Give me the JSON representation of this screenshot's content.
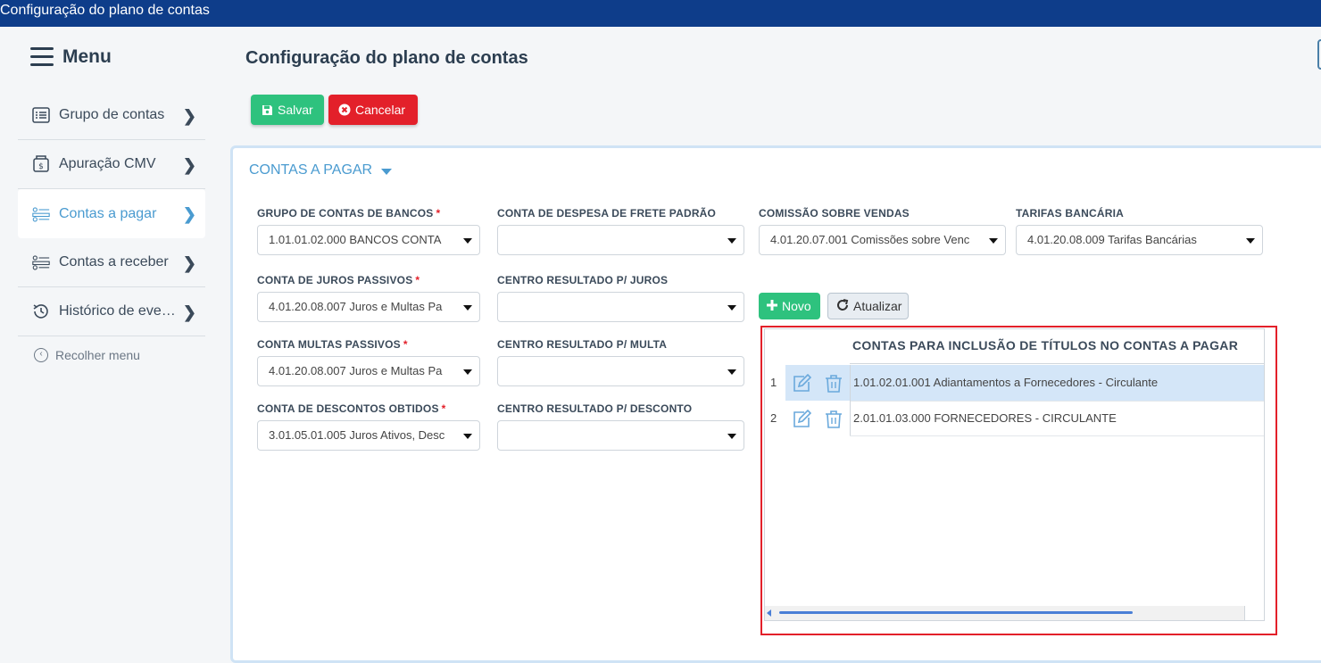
{
  "window": {
    "title": "Configuração do plano de contas"
  },
  "sidebar": {
    "menu_title": "Menu",
    "items": [
      {
        "label": "Grupo de contas",
        "icon": "list-icon",
        "active": false
      },
      {
        "label": "Apuração CMV",
        "icon": "money-box-icon",
        "active": false
      },
      {
        "label": "Contas a pagar",
        "icon": "accounts-list-icon",
        "active": true
      },
      {
        "label": "Contas a receber",
        "icon": "accounts-list-icon",
        "active": false
      },
      {
        "label": "Histórico de eve…",
        "icon": "history-icon",
        "active": false
      }
    ],
    "collapse_label": "Recolher menu"
  },
  "page": {
    "title": "Configuração do plano de contas",
    "save_label": "Salvar",
    "cancel_label": "Cancelar"
  },
  "section": {
    "title": "CONTAS A PAGAR",
    "fields": {
      "grupo_bancos": {
        "label": "GRUPO DE CONTAS DE BANCOS",
        "required": "*",
        "value": "1.01.01.02.000 BANCOS CONTA"
      },
      "despesa_frete": {
        "label": "CONTA DE DESPESA DE FRETE PADRÃO",
        "value": ""
      },
      "comissao": {
        "label": "COMISSÃO SOBRE VENDAS",
        "value": "4.01.20.07.001 Comissões sobre Venc"
      },
      "tarifas": {
        "label": "TARIFAS BANCÁRIA",
        "value": "4.01.20.08.009 Tarifas Bancárias"
      },
      "juros_passivos": {
        "label": "CONTA DE JUROS PASSIVOS",
        "required": "*",
        "value": "4.01.20.08.007 Juros e Multas Pa"
      },
      "centro_juros": {
        "label": "CENTRO RESULTADO P/ JUROS",
        "value": ""
      },
      "multas_passivos": {
        "label": "CONTA MULTAS PASSIVOS",
        "required": "*",
        "value": "4.01.20.08.007 Juros e Multas Pa"
      },
      "centro_multa": {
        "label": "CENTRO RESULTADO P/ MULTA",
        "value": ""
      },
      "descontos": {
        "label": "CONTA DE DESCONTOS OBTIDOS",
        "required": "*",
        "value": "3.01.05.01.005 Juros Ativos, Desc"
      },
      "centro_desconto": {
        "label": "CENTRO RESULTADO P/ DESCONTO",
        "value": ""
      }
    },
    "novo_label": "Novo",
    "atualizar_label": "Atualizar",
    "grid": {
      "title": "CONTAS PARA INCLUSÃO DE TÍTULOS NO CONTAS A PAGAR",
      "rows": [
        {
          "num": "1",
          "value": "1.01.02.01.001 Adiantamentos a Fornecedores - Circulante",
          "selected": true
        },
        {
          "num": "2",
          "value": "2.01.01.03.000 FORNECEDORES - CIRCULANTE",
          "selected": false
        }
      ]
    }
  },
  "colors": {
    "titlebar": "#0e3d8a",
    "accent": "#4a9bd0",
    "success": "#2ec27e",
    "danger": "#e3202a"
  }
}
